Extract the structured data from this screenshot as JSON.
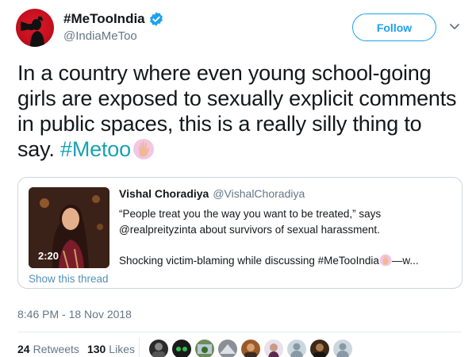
{
  "author": {
    "display_name": "#MeTooIndia",
    "handle": "@IndiaMeToo",
    "verified_icon": "verified-badge-icon",
    "avatar_icon": "megaphone-silhouette-icon"
  },
  "follow_label": "Follow",
  "tweet": {
    "text": "In a country where even young school-going girls are exposed to sexually explicit comments in public spaces, this is a really silly thing to say.",
    "hashtag": "#Metoo",
    "emoji": "raised-hand-emoji"
  },
  "quote": {
    "name": "Vishal Choradiya",
    "handle": "@VishalChoradiya",
    "line1": "“People treat you the way you want to be treated,” says",
    "line2": "@realpreityzinta about survivors of sexual harassment.",
    "line3_before": "Shocking victim-blaming while discussing #MeTooIndia",
    "line3_after": "—w...",
    "video_duration": "2:20",
    "show_thread": "Show this thread"
  },
  "timestamp": "8:46 PM - 18 Nov 2018",
  "stats": {
    "retweets_count": "24",
    "retweets_label": "Retweets",
    "likes_count": "130",
    "likes_label": "Likes"
  },
  "colors": {
    "accent": "#1da1f2",
    "hashtag": "#1aa1b2",
    "avatar_red": "#c8101f"
  }
}
